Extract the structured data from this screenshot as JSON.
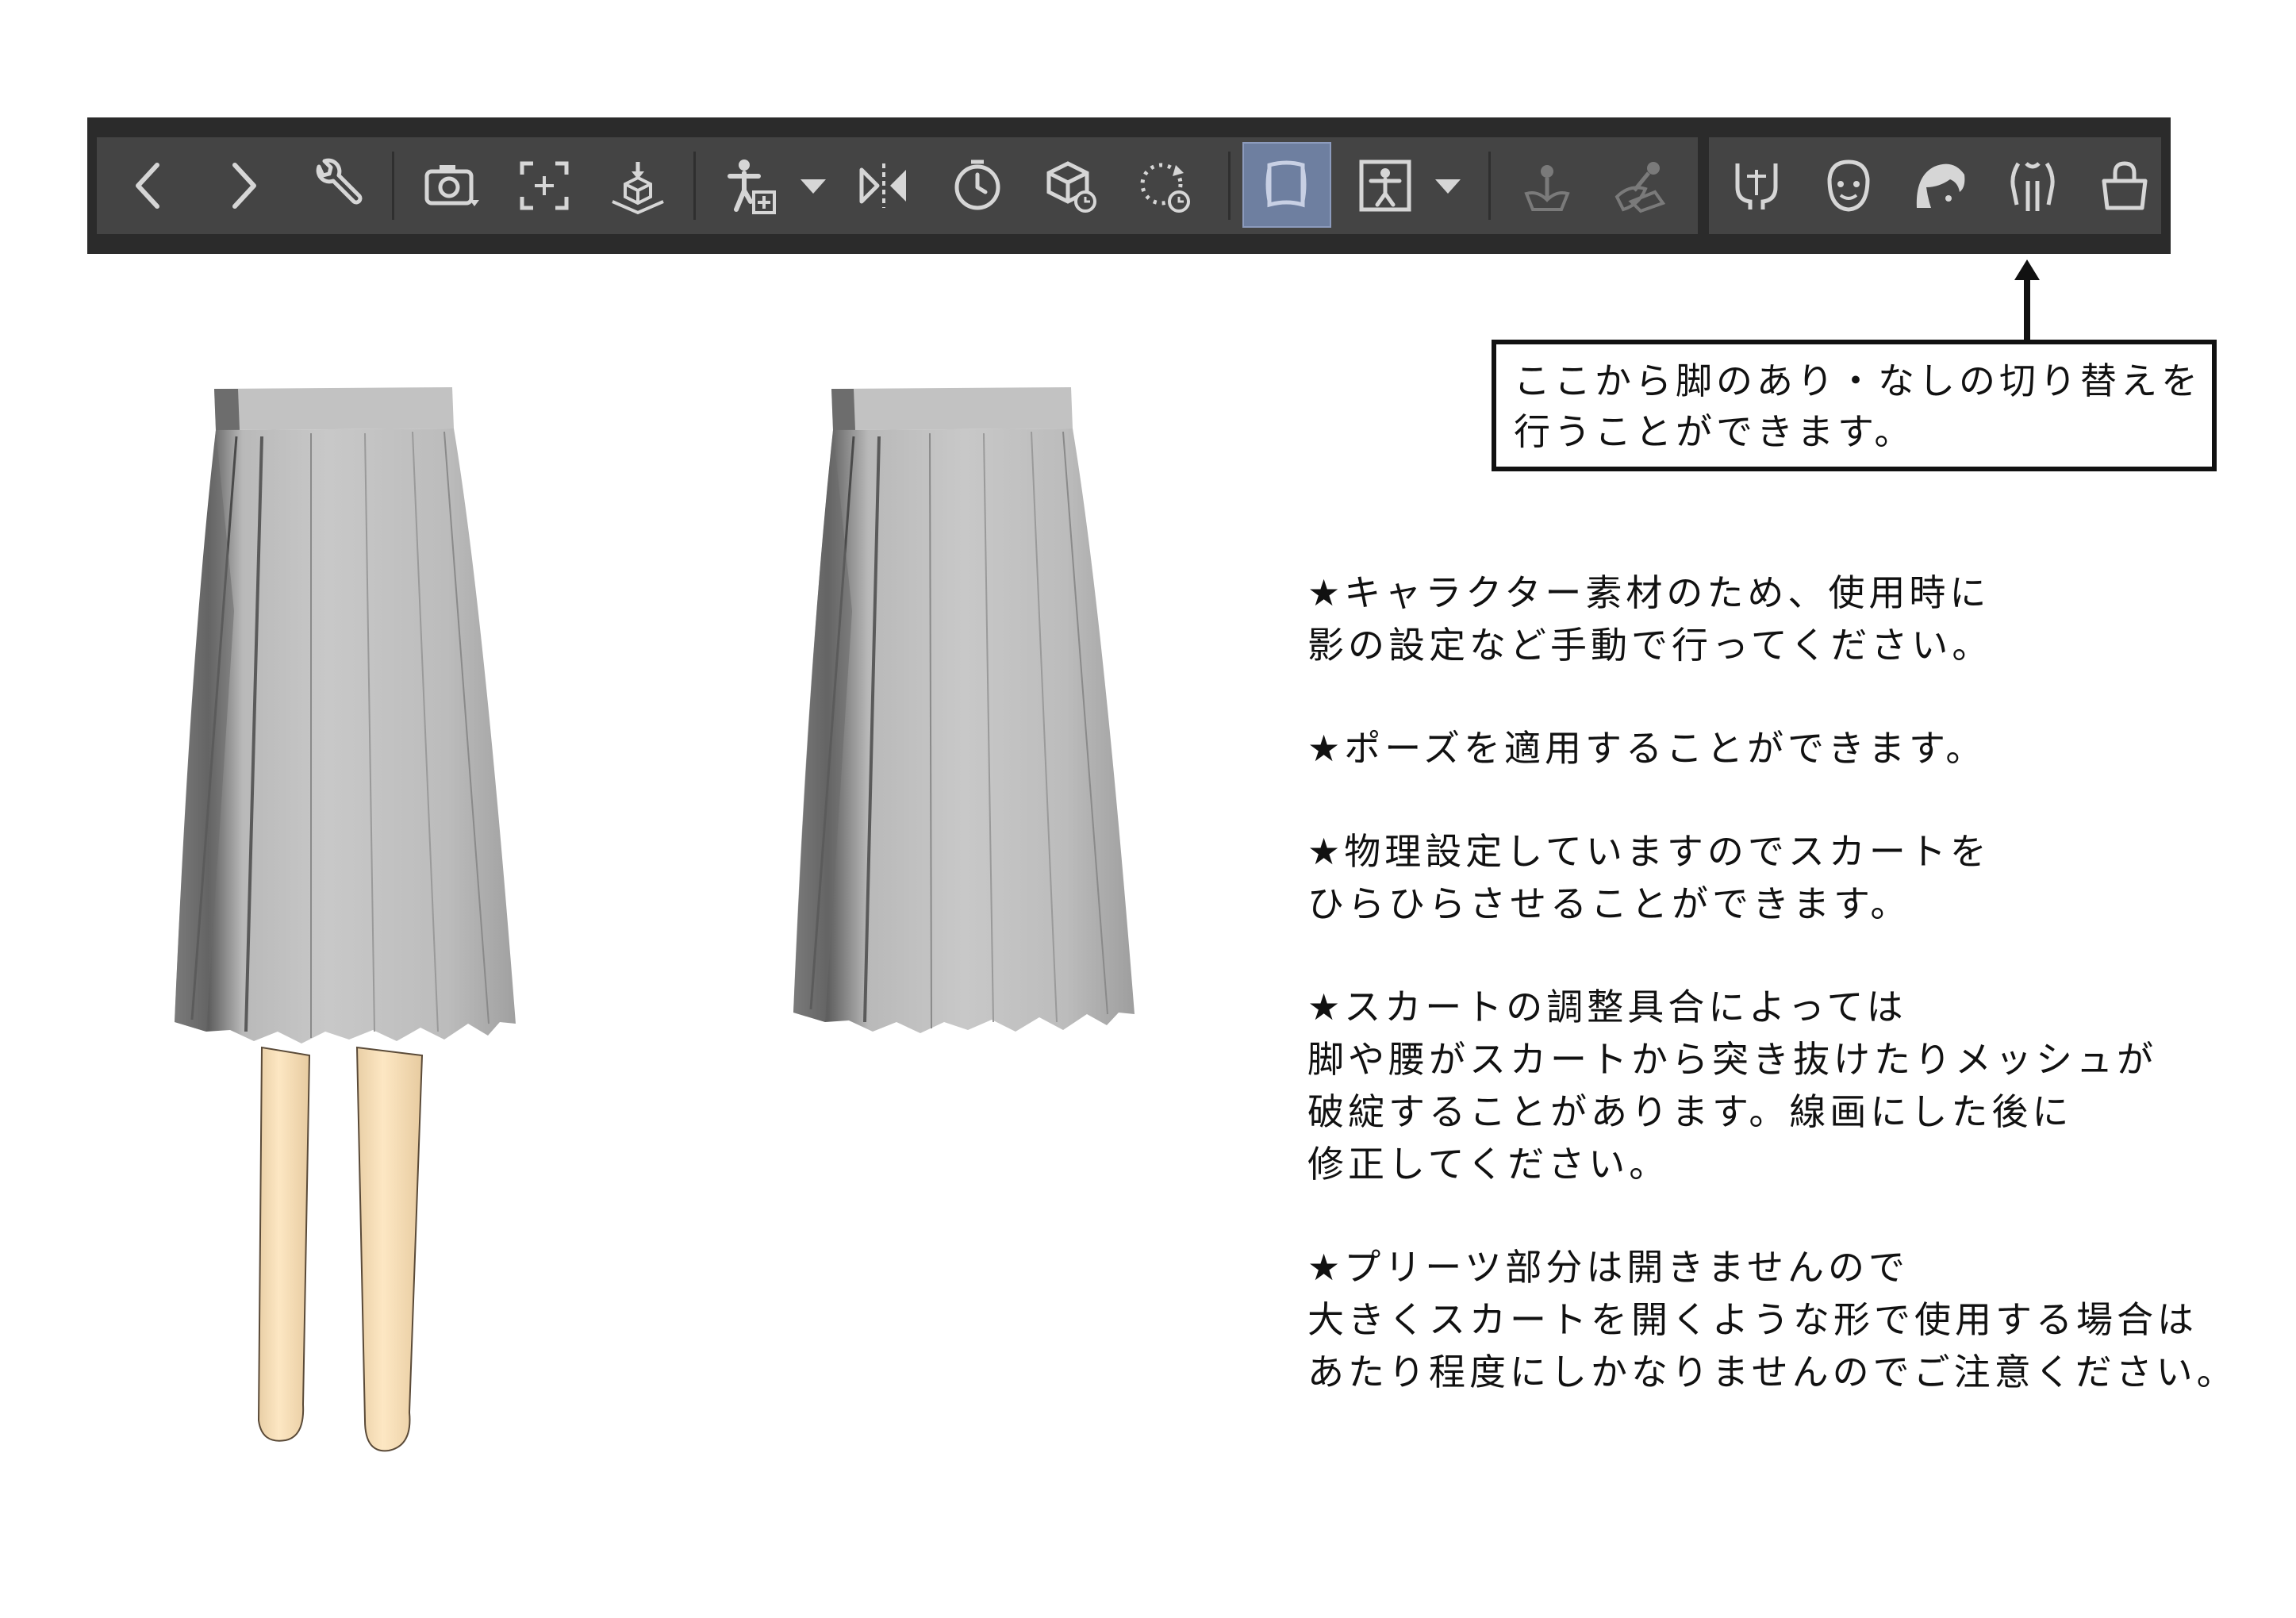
{
  "toolbar": {
    "buttons": [
      {
        "name": "back-icon",
        "icon": "chevron-left"
      },
      {
        "name": "forward-icon",
        "icon": "chevron-right"
      },
      {
        "name": "wrench-icon",
        "icon": "wrench"
      },
      {
        "name": "camera-icon",
        "icon": "camera"
      },
      {
        "name": "focus-icon",
        "icon": "focus-frame"
      },
      {
        "name": "ground-icon",
        "icon": "cube-on-ground"
      },
      {
        "name": "add-figure-icon",
        "icon": "figure-add"
      },
      {
        "name": "mirror-icon",
        "icon": "flip-horizontal"
      },
      {
        "name": "timer-icon",
        "icon": "clock"
      },
      {
        "name": "reset-cube-icon",
        "icon": "cube-reset"
      },
      {
        "name": "rotate-reset-icon",
        "icon": "rotate-dotted"
      },
      {
        "name": "cloth-toggle-icon",
        "icon": "cloth",
        "active": true
      },
      {
        "name": "pose-icon",
        "icon": "figure-pose"
      },
      {
        "name": "bake-physics-icon",
        "icon": "plant-gray"
      },
      {
        "name": "physics-leaf-icon",
        "icon": "leaf-gray"
      },
      {
        "name": "legs-toggle-icon",
        "icon": "legs"
      },
      {
        "name": "face-icon",
        "icon": "face"
      },
      {
        "name": "hair-icon",
        "icon": "hair"
      },
      {
        "name": "body-icon",
        "icon": "body"
      },
      {
        "name": "bag-icon",
        "icon": "bag"
      }
    ]
  },
  "callout": {
    "line1": "ここから脚のあり・なしの切り替えを",
    "line2": "行うことができます。"
  },
  "notes": [
    {
      "lines": [
        "★キャラクター素材のため、使用時に",
        "影の設定など手動で行ってください。"
      ]
    },
    {
      "lines": [
        "★ポーズを適用することができます。"
      ]
    },
    {
      "lines": [
        "★物理設定していますのでスカートを",
        "ひらひらさせることができます。"
      ]
    },
    {
      "lines": [
        "★スカートの調整具合によっては",
        "脚や腰がスカートから突き抜けたりメッシュが",
        "破綻することがあります。線画にした後に",
        "修正してください。"
      ]
    },
    {
      "lines": [
        "★プリーツ部分は開きませんので",
        "大きくスカートを開くような形で使用する場合は",
        "あたり程度にしかなりませんのでご注意ください。"
      ]
    }
  ],
  "colors": {
    "toolbar_bg": "#2b2b2b",
    "toolbar_panel": "#444444",
    "icon": "#d6d6d6",
    "icon_disabled": "#7a7a7a",
    "active_bg": "#6e7fa0",
    "skirt": "#bdbdbd",
    "legs": "#f7dfb8"
  }
}
